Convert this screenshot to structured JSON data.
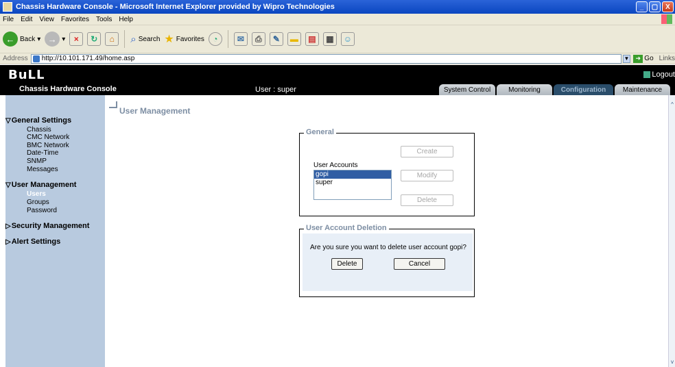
{
  "window": {
    "title": "Chassis Hardware Console - Microsoft Internet Explorer provided by Wipro Technologies",
    "controls": [
      "_",
      "▢",
      "X"
    ]
  },
  "menu": [
    "File",
    "Edit",
    "View",
    "Favorites",
    "Tools",
    "Help"
  ],
  "toolbar": {
    "back_label": "Back",
    "search_label": "Search",
    "favorites_label": "Favorites"
  },
  "address": {
    "label": "Address",
    "url": "http://10.101.171.49/home.asp",
    "go_label": "Go",
    "links_label": "Links"
  },
  "app": {
    "logo": "BuLL",
    "console_title": "Chassis Hardware Console",
    "user_text": "User : super",
    "logout_label": "Logout",
    "tabs": [
      {
        "label": "System Control",
        "active": false
      },
      {
        "label": "Monitoring",
        "active": false
      },
      {
        "label": "Configuration",
        "active": true
      },
      {
        "label": "Maintenance",
        "active": false
      }
    ]
  },
  "sidebar": {
    "sections": [
      {
        "label": "General Settings",
        "expanded": true,
        "items": [
          "Chassis",
          "CMC Network",
          "BMC Network",
          "Date-Time",
          "SNMP",
          "Messages"
        ]
      },
      {
        "label": "User Management",
        "expanded": true,
        "items": [
          "Users",
          "Groups",
          "Password"
        ],
        "active_item": "Users"
      },
      {
        "label": "Security Management",
        "expanded": false,
        "items": []
      },
      {
        "label": "Alert Settings",
        "expanded": false,
        "items": []
      }
    ]
  },
  "main": {
    "page_title": "User Management",
    "general": {
      "legend": "General",
      "accounts_label": "User Accounts",
      "accounts": [
        "gopi",
        "super"
      ],
      "selected": "gopi",
      "create_label": "Create",
      "modify_label": "Modify",
      "delete_label": "Delete"
    },
    "deletion": {
      "legend": "User Account Deletion",
      "message": "Are you sure you want to delete user account gopi?",
      "delete_label": "Delete",
      "cancel_label": "Cancel"
    }
  }
}
